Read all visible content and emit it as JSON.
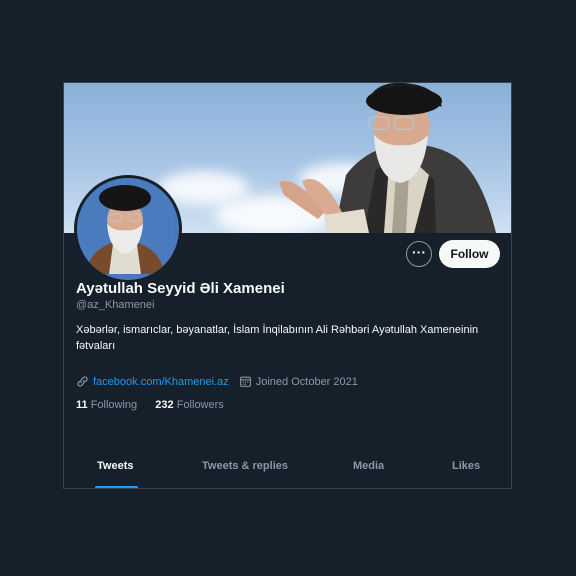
{
  "profile": {
    "name": "Ayətullah Seyyid Əli Xamenei",
    "handle": "@az_Khamenei",
    "bio": "Xəbərlər, ismarıclar, bəyanatlar, İslam İnqilabının Ali Rəhbəri Ayətullah Xameneinin fətvaları",
    "link": "facebook.com/Khamenei.az",
    "joined": "Joined October 2021",
    "following_count": "11",
    "following_label": "Following",
    "followers_count": "232",
    "followers_label": "Followers"
  },
  "actions": {
    "more": "···",
    "follow": "Follow"
  },
  "tabs": [
    {
      "label": "Tweets",
      "active": true
    },
    {
      "label": "Tweets & replies",
      "active": false
    },
    {
      "label": "Media",
      "active": false
    },
    {
      "label": "Likes",
      "active": false
    }
  ],
  "colors": {
    "background": "#15202b",
    "accent": "#1d9bf0",
    "text_primary": "#f7f9f9",
    "text_secondary": "#8b98a5"
  },
  "icons": {
    "link": "link-icon",
    "calendar": "calendar-icon",
    "more": "more-icon"
  }
}
